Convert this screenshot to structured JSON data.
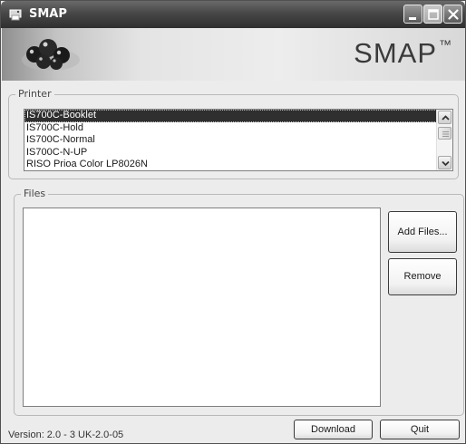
{
  "window": {
    "title": "SMAP",
    "icon": "smap-app-icon",
    "controls": [
      "minimize-icon",
      "maximize-icon",
      "close-icon"
    ]
  },
  "banner": {
    "product_name": "SMAP",
    "trademark": "™",
    "logo": "balls-logo"
  },
  "printer_group": {
    "label": "Printer",
    "items": [
      "IS700C-Booklet",
      "IS700C-Hold",
      "IS700C-Normal",
      "IS700C-N-UP",
      "RISO Prioa Color LP8026N"
    ],
    "selected_index": 0
  },
  "files_group": {
    "label": "Files",
    "add_files_label": "Add Files...",
    "remove_label": "Remove"
  },
  "footer": {
    "version_text": "Version: 2.0 - 3 UK-2.0-05",
    "download_label": "Download",
    "quit_label": "Quit"
  }
}
